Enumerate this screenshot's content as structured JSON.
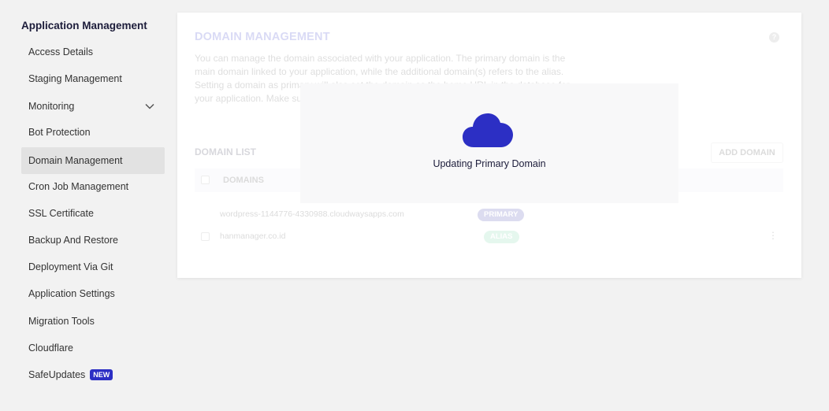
{
  "sidebar": {
    "title": "Application Management",
    "items": [
      {
        "label": "Access Details"
      },
      {
        "label": "Staging Management"
      },
      {
        "label": "Monitoring"
      },
      {
        "label": "Bot Protection"
      },
      {
        "label": "Domain Management"
      },
      {
        "label": "Cron Job Management"
      },
      {
        "label": "SSL Certificate"
      },
      {
        "label": "Backup And Restore"
      },
      {
        "label": "Deployment Via Git"
      },
      {
        "label": "Application Settings"
      },
      {
        "label": "Migration Tools"
      },
      {
        "label": "Cloudflare"
      },
      {
        "label": "SafeUpdates",
        "badge": "NEW"
      }
    ],
    "active_item": "Domain Management"
  },
  "panel": {
    "title": "DOMAIN MANAGEMENT",
    "description": "You can manage the domain associated with your application. The primary domain is the main domain linked to your application, while the additional domain(s) refers to the alias. Setting a domain as primary will also set the domain as the home URL in the database for your application. Make sure your domain is pointed to your server's IP address to work.",
    "help_icon": "?",
    "list_title": "DOMAIN LIST",
    "add_button": "ADD DOMAIN",
    "table": {
      "column_header": "DOMAINS",
      "rows": [
        {
          "domain": "wordpress-1144776-4330988.cloudwaysapps.com",
          "tag": "PRIMARY"
        },
        {
          "domain": "hanmanager.co.id",
          "tag": "ALIAS"
        }
      ]
    }
  },
  "loader": {
    "message": "Updating Primary Domain",
    "icon": "cloud-icon"
  },
  "colors": {
    "brand": "#2c2fc4",
    "alias": "#6ed3a0",
    "active_bg": "#e2e2e2"
  }
}
